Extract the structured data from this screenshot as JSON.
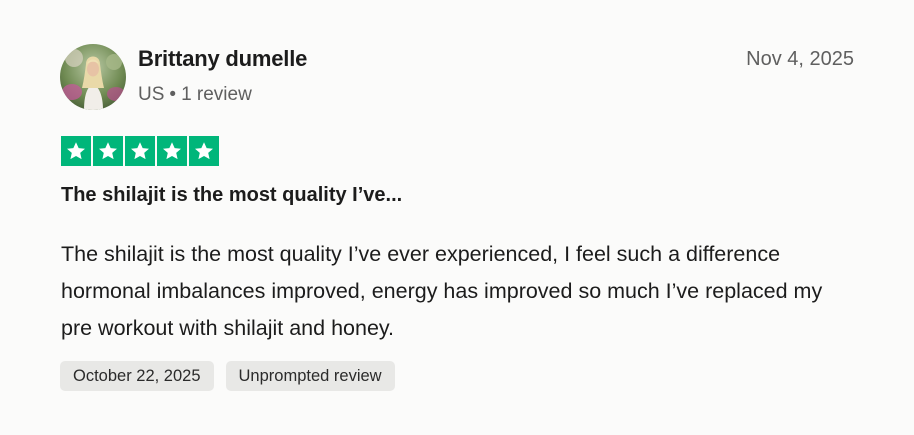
{
  "reviewer": {
    "name": "Brittany dumelle",
    "country": "US",
    "separator": "•",
    "review_count": "1 review",
    "avatar_icon": "user-photo-avatar"
  },
  "review": {
    "date": "Nov 4, 2025",
    "rating": 5,
    "rating_max": 5,
    "star_color": "#00b67a",
    "title": "The shilajit is the most quality I’ve...",
    "body": "The shilajit is the most quality I’ve ever experienced, I feel such a difference hormonal imbalances improved, energy has improved so much I’ve replaced my pre workout with shilajit and honey."
  },
  "tags": {
    "experience_date": "October 22, 2025",
    "review_type": "Unprompted review"
  }
}
